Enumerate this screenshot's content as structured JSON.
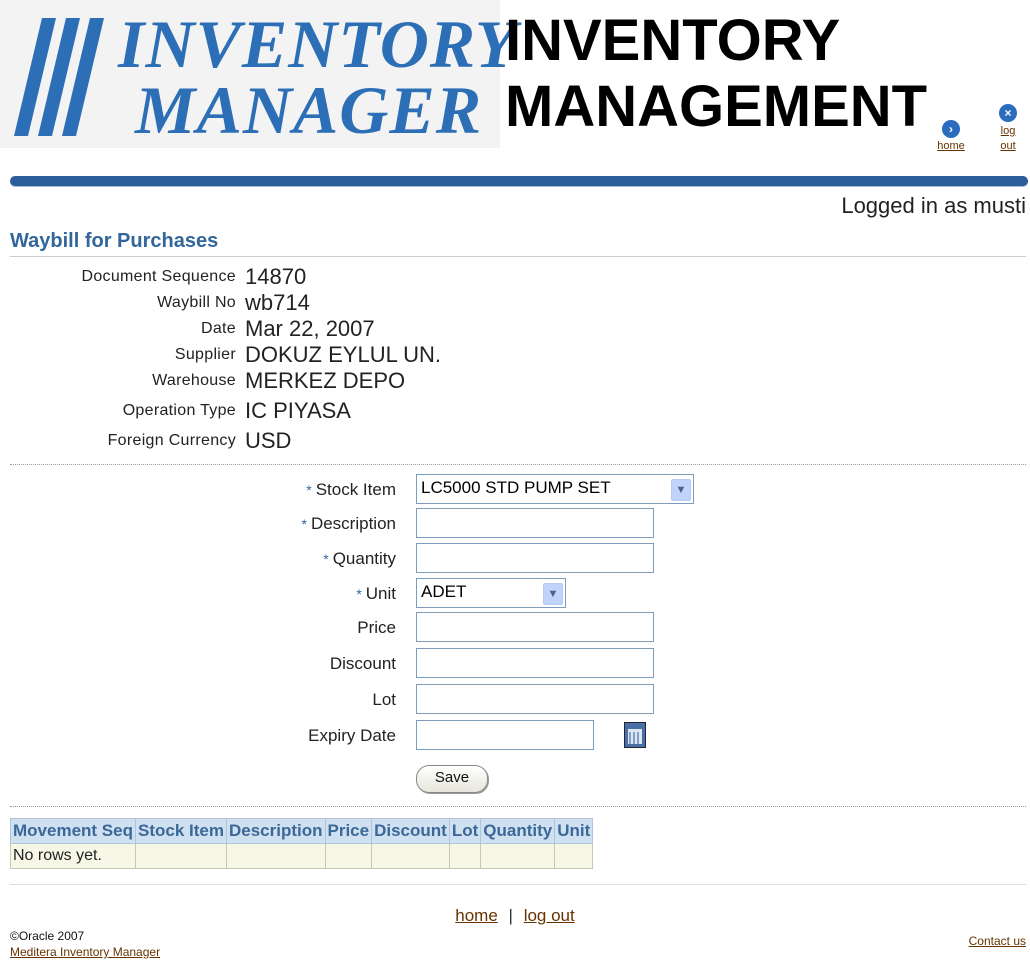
{
  "header": {
    "logo_line1": "INVENTORY",
    "logo_line2": "MANAGER",
    "title_line1": "INVENTORY",
    "title_line2": "MANAGEMENT",
    "home_label": "home",
    "logout_label1": "log",
    "logout_label2": "out",
    "logged_in": "Logged in as musti",
    "brand_color": "#2d6fb6",
    "bar_color": "#2c5d9b"
  },
  "page": {
    "title": "Waybill for Purchases"
  },
  "details": [
    {
      "label": "Document Sequence",
      "value": "14870"
    },
    {
      "label": "Waybill No",
      "value": "wb714"
    },
    {
      "label": "Date",
      "value": "Mar 22, 2007"
    },
    {
      "label": "Supplier",
      "value": "DOKUZ EYLUL UN."
    },
    {
      "label": "Warehouse",
      "value": "MERKEZ DEPO"
    },
    {
      "label": "Operation Type",
      "value": "IC PIYASA"
    },
    {
      "label": "Foreign Currency",
      "value": "USD"
    }
  ],
  "form": {
    "required_mark": "*",
    "stock_item": {
      "label": "Stock Item",
      "value": "LC5000 STD PUMP SET"
    },
    "description": {
      "label": "Description",
      "value": ""
    },
    "quantity": {
      "label": "Quantity",
      "value": ""
    },
    "unit": {
      "label": "Unit",
      "value": "ADET"
    },
    "price": {
      "label": "Price",
      "value": ""
    },
    "discount": {
      "label": "Discount",
      "value": ""
    },
    "lot": {
      "label": "Lot",
      "value": ""
    },
    "expiry": {
      "label": "Expiry Date",
      "value": ""
    },
    "save_label": "Save"
  },
  "table": {
    "columns": [
      "Movement Seq",
      "Stock Item",
      "Description",
      "Price",
      "Discount",
      "Lot",
      "Quantity",
      "Unit"
    ],
    "empty_text": "No rows yet."
  },
  "footer": {
    "home": "home",
    "separator": "|",
    "logout": "log out",
    "copyright": "©Oracle 2007",
    "product_link": "Meditera Inventory Manager",
    "contact": "Contact us"
  }
}
